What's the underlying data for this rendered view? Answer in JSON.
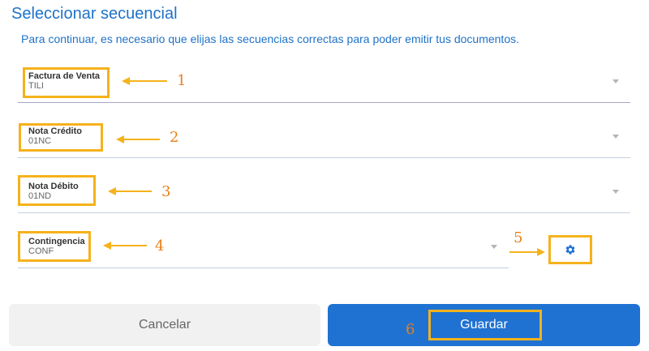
{
  "header": {
    "title": "Seleccionar secuencial",
    "subtitle": "Para continuar, es necesario que elijas las secuencias correctas para poder emitir tus documentos."
  },
  "fields": [
    {
      "label": "Factura de Venta",
      "value": "TILI",
      "annotation": "1"
    },
    {
      "label": "Nota Crédito",
      "value": "01NC",
      "annotation": "2"
    },
    {
      "label": "Nota Débito",
      "value": "01ND",
      "annotation": "3"
    },
    {
      "label": "Contingencia",
      "value": "CONF",
      "annotation": "4"
    }
  ],
  "settings": {
    "icon": "gear-icon",
    "annotation": "5"
  },
  "buttons": {
    "cancel_label": "Cancelar",
    "save_label": "Guardar",
    "save_annotation": "6"
  },
  "colors": {
    "primary": "#1f72d2",
    "highlight": "#f5b21c",
    "annotation_number": "#e8801a"
  }
}
